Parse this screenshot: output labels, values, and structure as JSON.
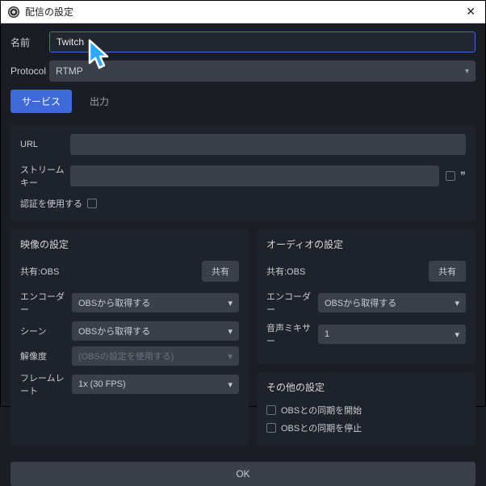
{
  "titlebar": {
    "title": "配信の設定"
  },
  "form": {
    "name_label": "名前",
    "name_value": "Twitch",
    "protocol_label": "Protocol",
    "protocol_value": "RTMP"
  },
  "tabs": {
    "service": "サービス",
    "output": "出力"
  },
  "stream": {
    "url_label": "URL",
    "key_label": "ストリームキー",
    "auth_label": "認証を使用する"
  },
  "video": {
    "heading": "映像の設定",
    "share_label": "共有:OBS",
    "share_btn": "共有",
    "encoder_label": "エンコーダー",
    "encoder_value": "OBSから取得する",
    "scene_label": "シーン",
    "scene_value": "OBSから取得する",
    "res_label": "解像度",
    "res_placeholder": "(OBSの設定を使用する)",
    "fps_label": "フレームレート",
    "fps_value": "1x (30 FPS)"
  },
  "audio": {
    "heading": "オーディオの設定",
    "share_label": "共有:OBS",
    "share_btn": "共有",
    "encoder_label": "エンコーダー",
    "encoder_value": "OBSから取得する",
    "mixer_label": "音声ミキサー",
    "mixer_value": "1"
  },
  "other": {
    "heading": "その他の設定",
    "sync_start": "OBSとの同期を開始",
    "sync_stop": "OBSとの同期を停止"
  },
  "footer": {
    "ok": "OK"
  }
}
